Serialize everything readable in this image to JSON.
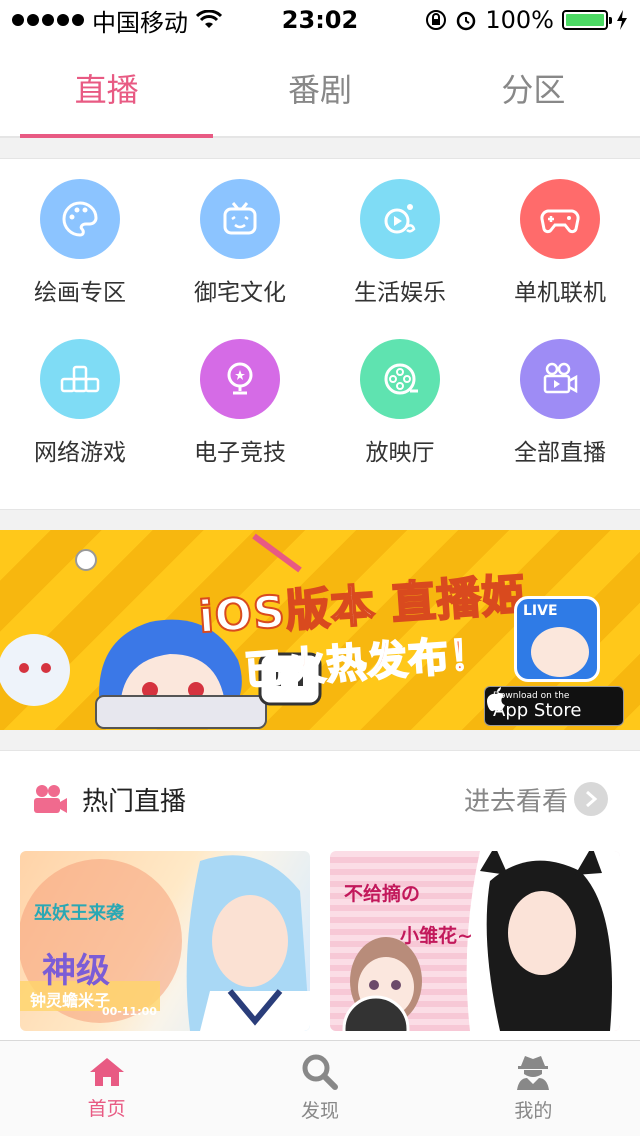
{
  "status_bar": {
    "carrier": "中国移动",
    "time": "23:02",
    "battery": "100%",
    "battery_level": 1.0
  },
  "top_tabs": [
    {
      "label": "直播",
      "active": true
    },
    {
      "label": "番剧",
      "active": false
    },
    {
      "label": "分区",
      "active": false
    }
  ],
  "categories": [
    {
      "label": "绘画专区",
      "icon": "palette-icon",
      "color": "#8cc4ff"
    },
    {
      "label": "御宅文化",
      "icon": "tv-face-icon",
      "color": "#8cc4ff"
    },
    {
      "label": "生活娱乐",
      "icon": "play-bubble-icon",
      "color": "#7fdcf5"
    },
    {
      "label": "单机联机",
      "icon": "gamepad-icon",
      "color": "#ff6b6b"
    },
    {
      "label": "网络游戏",
      "icon": "blocks-icon",
      "color": "#7fdcf5"
    },
    {
      "label": "电子竞技",
      "icon": "trophy-icon",
      "color": "#d56be6"
    },
    {
      "label": "放映厅",
      "icon": "film-reel-icon",
      "color": "#5fe3b0"
    },
    {
      "label": "全部直播",
      "icon": "video-camera-icon",
      "color": "#9e8cf5"
    }
  ],
  "banner": {
    "title_line1": "iOS版本 直播姬",
    "title_line2": "已火热发布！",
    "live_badge": "LIVE",
    "appstore_small": "Download on the",
    "appstore_big": "App Store"
  },
  "hot_live": {
    "title": "热门直播",
    "more_label": "进去看看",
    "thumbnails": [
      {
        "text1": "巫妖王来袭",
        "text2": "神级",
        "text3": "钟灵蟾米子",
        "text4": "00-11:00"
      },
      {
        "text1": "不给摘の",
        "text2": "小雏花~"
      }
    ]
  },
  "bottom_tabs": [
    {
      "label": "首页",
      "icon": "home-icon",
      "active": true
    },
    {
      "label": "发现",
      "icon": "search-icon",
      "active": false
    },
    {
      "label": "我的",
      "icon": "user-spy-icon",
      "active": false
    }
  ],
  "colors": {
    "accent": "#e85a83",
    "banner_yellow": "#ffc81a"
  }
}
